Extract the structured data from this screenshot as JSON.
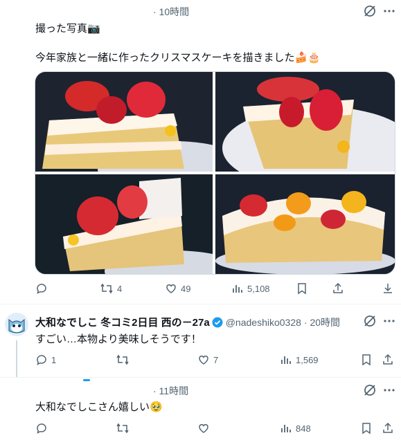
{
  "post1": {
    "time": "· 10時間",
    "line1": "撮った写真📷",
    "line2": "今年家族と一緒に作ったクリスマスケーキを描きました🍰🎂",
    "images": [
      "cake-photo-1",
      "cake-photo-2",
      "cake-photo-3",
      "cake-photo-4"
    ],
    "actions": {
      "reply": "",
      "repost": "4",
      "like": "49",
      "views": "5,108"
    }
  },
  "reply1": {
    "name": "大和なでしこ 冬コミ2日目 西の－27a",
    "handle": "@nadeshiko0328",
    "time": "· 20時間",
    "text": "すごい…本物より美味しそうです！",
    "actions": {
      "reply": "1",
      "repost": "",
      "like": "7",
      "views": "1,569"
    }
  },
  "reply2": {
    "time": "· 11時間",
    "text": "大和なでしこさん嬉しい🥹",
    "actions": {
      "reply": "",
      "repost": "",
      "like": "",
      "views": "848"
    }
  },
  "colors": {
    "accent": "#1d9bf0",
    "text": "#0f1419",
    "muted": "#536471",
    "border": "#eff3f4"
  }
}
